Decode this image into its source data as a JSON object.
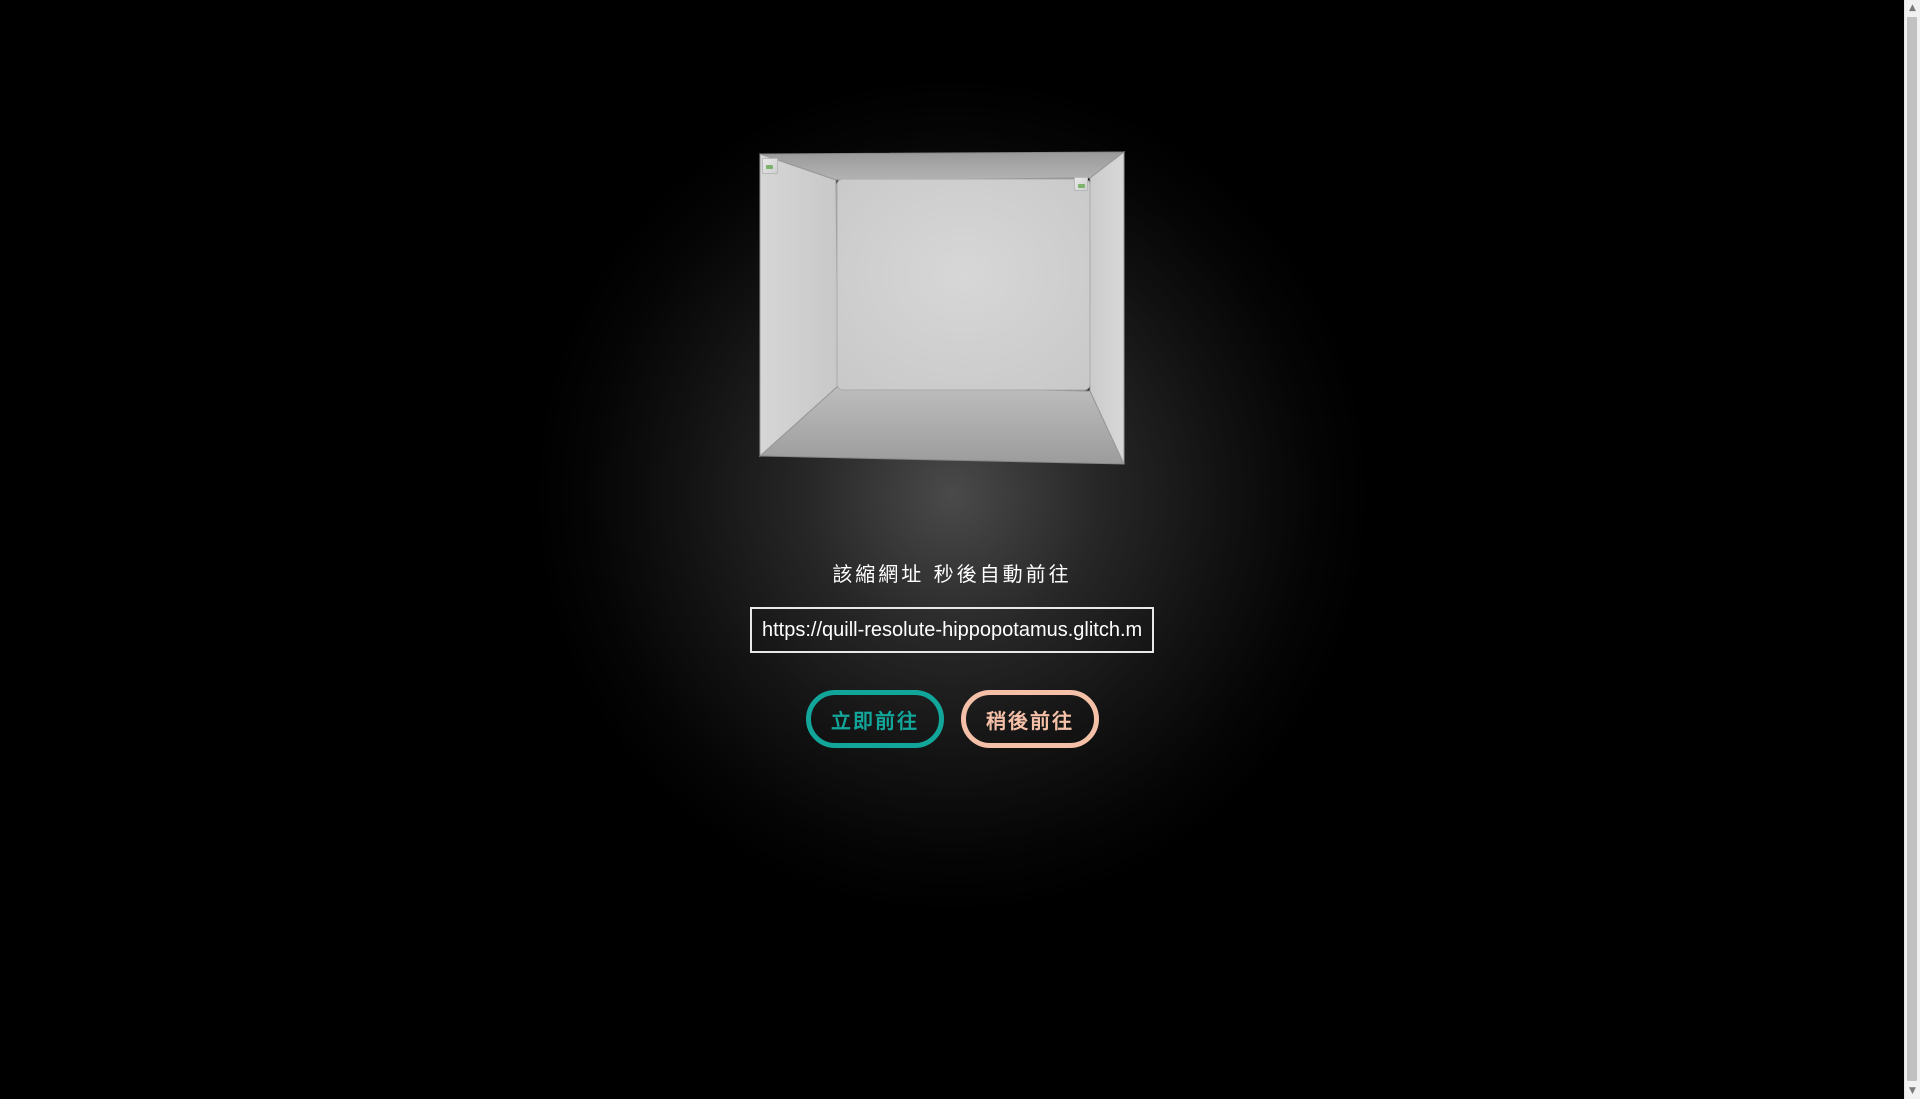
{
  "message": "該縮網址 秒後自動前往",
  "url_field": {
    "value": "https://quill-resolute-hippopotamus.glitch.me"
  },
  "buttons": {
    "go_now": "立即前往",
    "go_later": "稍後前往"
  },
  "colors": {
    "background": "#000000",
    "go_now_accent": "#12a69b",
    "go_later_accent": "#f5c0a8",
    "cube_face": "#cfcfcf"
  },
  "icons": {
    "cube_decor": "3d-cube-room",
    "broken_image_left": "broken-image-icon",
    "broken_image_right": "broken-image-icon",
    "scroll_up": "triangle-up",
    "scroll_down": "triangle-down"
  }
}
